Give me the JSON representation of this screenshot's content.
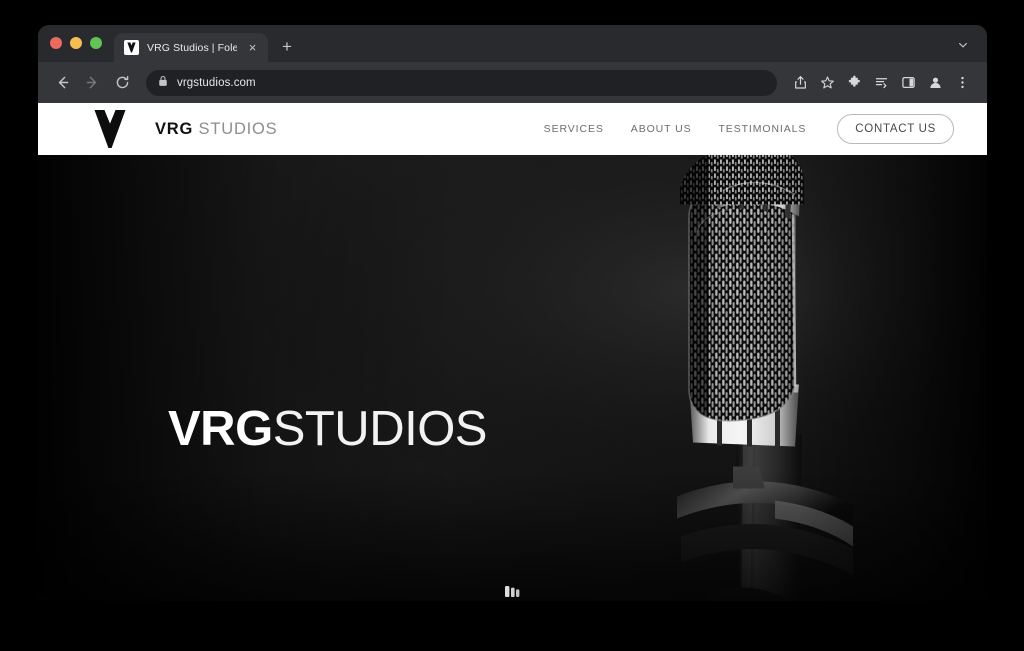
{
  "browser": {
    "traffic_lights": [
      "close",
      "minimize",
      "maximize"
    ],
    "tab": {
      "title": "VRG Studios | Foley Production",
      "favicon_name": "vrg-logo-favicon",
      "close_label": "×"
    },
    "new_tab_label": "+",
    "tab_list_icon": "chevron-down-icon",
    "nav": {
      "back_icon": "arrow-left-icon",
      "forward_icon": "arrow-right-icon",
      "reload_icon": "reload-icon"
    },
    "omnibox": {
      "security_icon": "lock-icon",
      "url": "vrgstudios.com"
    },
    "actions": [
      {
        "name": "share-icon",
        "label": "Share"
      },
      {
        "name": "bookmark-star-icon",
        "label": "Bookmark"
      },
      {
        "name": "extensions-puzzle-icon",
        "label": "Extensions"
      },
      {
        "name": "reading-list-icon",
        "label": "Reading list"
      },
      {
        "name": "side-panel-icon",
        "label": "Side panel"
      },
      {
        "name": "profile-avatar-icon",
        "label": "Profile"
      },
      {
        "name": "more-menu-icon",
        "label": "Customize and control"
      }
    ]
  },
  "site": {
    "logo": {
      "mark_name": "vrg-v-mark",
      "name_bold": "VRG",
      "name_light": " STUDIOS"
    },
    "nav_links": [
      {
        "label": "SERVICES"
      },
      {
        "label": "ABOUT US"
      },
      {
        "label": "TESTIMONIALS"
      }
    ],
    "contact_button": "CONTACT US",
    "hero": {
      "title_bold": "VRG",
      "title_light": "STUDIOS",
      "image_name": "condenser-microphone-photo",
      "background_color": "#1c1c1c",
      "scroll_hint_name": "scroll-down-indicator"
    }
  }
}
